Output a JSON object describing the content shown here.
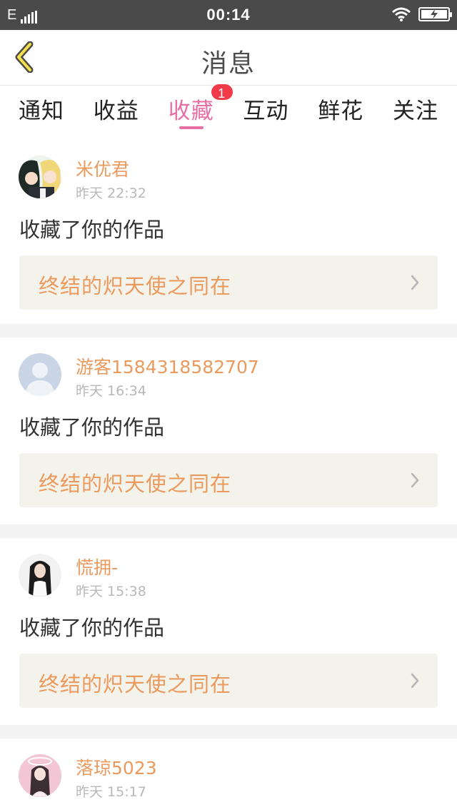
{
  "status_bar": {
    "network": "E",
    "time": "00:14"
  },
  "header": {
    "title": "消息"
  },
  "tabs": [
    {
      "label": "通知",
      "active": false
    },
    {
      "label": "收益",
      "active": false
    },
    {
      "label": "收藏",
      "active": true,
      "badge": "1"
    },
    {
      "label": "互动",
      "active": false
    },
    {
      "label": "鲜花",
      "active": false
    },
    {
      "label": "关注",
      "active": false
    }
  ],
  "colors": {
    "accent": "#e76fa6",
    "username": "#eb9a5e",
    "badge": "#f23b4a"
  },
  "feed": [
    {
      "username": "米优君",
      "time": "昨天 22:32",
      "action": "收藏了你的作品",
      "work_title": "终结的炽天使之同在",
      "avatar": "anime-pair-avatar"
    },
    {
      "username": "游客1584318582707",
      "time": "昨天 16:34",
      "action": "收藏了你的作品",
      "work_title": "终结的炽天使之同在",
      "avatar": "default-user-avatar"
    },
    {
      "username": "慌拥-",
      "time": "昨天 15:38",
      "action": "收藏了你的作品",
      "work_title": "终结的炽天使之同在",
      "avatar": "girl-photo-avatar"
    },
    {
      "username": "落琼5023",
      "time": "昨天 15:17",
      "avatar": "pink-portrait-avatar"
    }
  ]
}
